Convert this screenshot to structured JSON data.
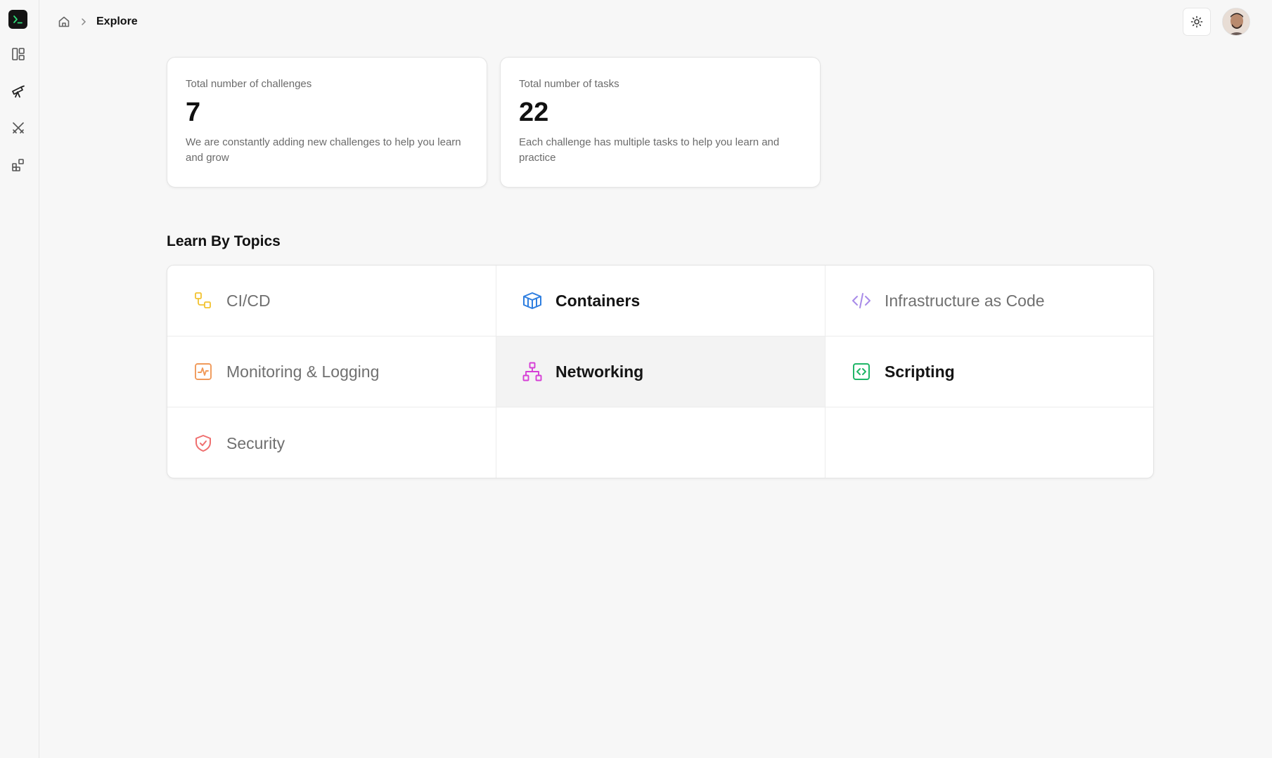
{
  "breadcrumb": {
    "current": "Explore"
  },
  "sidebar": {
    "items": [
      {
        "icon": "terminal-icon"
      },
      {
        "icon": "dashboard-icon"
      },
      {
        "icon": "telescope-icon"
      },
      {
        "icon": "swords-icon"
      },
      {
        "icon": "blocks-icon"
      }
    ]
  },
  "stats": [
    {
      "label": "Total number of challenges",
      "value": "7",
      "desc": "We are constantly adding new challenges to help you learn and grow"
    },
    {
      "label": "Total number of tasks",
      "value": "22",
      "desc": "Each challenge has multiple tasks to help you learn and practice"
    }
  ],
  "section": {
    "title": "Learn By Topics"
  },
  "topics": [
    {
      "label": "CI/CD",
      "icon": "pipeline-icon",
      "color": "#f2c230"
    },
    {
      "label": "Containers",
      "icon": "container-box-icon",
      "color": "#2f7fe0"
    },
    {
      "label": "Infrastructure as Code",
      "icon": "code-brackets-icon",
      "color": "#a88be8"
    },
    {
      "label": "Monitoring & Logging",
      "icon": "activity-icon",
      "color": "#f09a5a"
    },
    {
      "label": "Networking",
      "icon": "network-icon",
      "color": "#d63fd6"
    },
    {
      "label": "Scripting",
      "icon": "script-icon",
      "color": "#1fb567"
    },
    {
      "label": "Security",
      "icon": "shield-check-icon",
      "color": "#ef6f6f"
    }
  ]
}
